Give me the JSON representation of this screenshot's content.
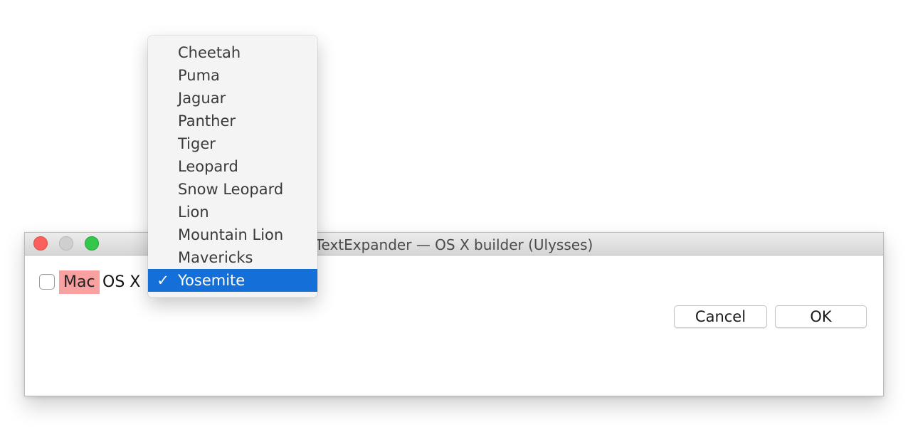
{
  "window": {
    "title": "TextExpander — OS X builder (Ulysses)"
  },
  "form": {
    "tokens": [
      "Mac",
      "OS X"
    ],
    "checkbox_checked": false
  },
  "popup_menu": {
    "items": [
      {
        "label": "Cheetah"
      },
      {
        "label": "Puma"
      },
      {
        "label": "Jaguar"
      },
      {
        "label": "Panther"
      },
      {
        "label": "Tiger"
      },
      {
        "label": "Leopard"
      },
      {
        "label": "Snow Leopard"
      },
      {
        "label": "Lion"
      },
      {
        "label": "Mountain Lion"
      },
      {
        "label": "Mavericks"
      },
      {
        "label": "Yosemite"
      }
    ],
    "selected_index": 10,
    "check_mark": "✓"
  },
  "buttons": {
    "cancel_label": "Cancel",
    "ok_label": "OK"
  },
  "colors": {
    "selection": "#1470d8",
    "token_highlight": "#f8a1a0"
  }
}
